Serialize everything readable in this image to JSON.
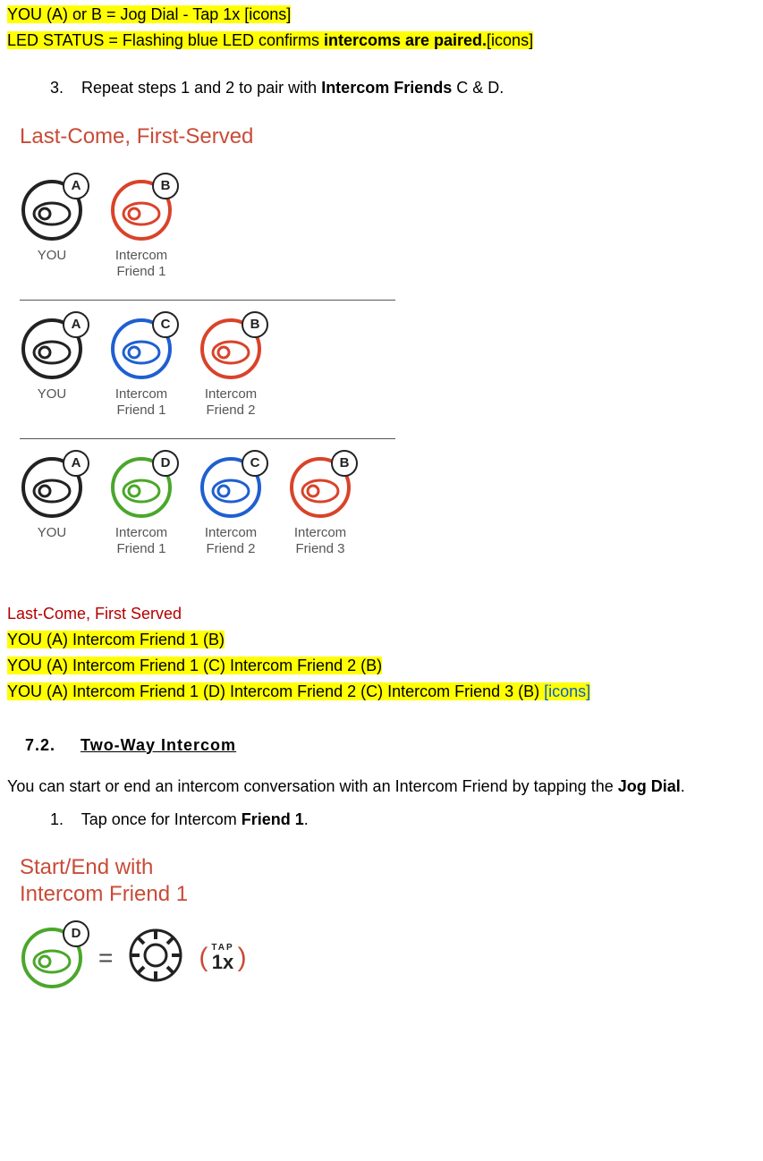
{
  "highlight1_prefix": "YOU (A) or B = Jog Dial - Tap 1x ",
  "highlight1_icons": "[icons]",
  "highlight2_prefix": "LED STATUS = Flashing blue LED confirms ",
  "highlight2_bold": "intercoms are paired.",
  "highlight2_icons": "[icons]",
  "step3_num": "3.",
  "step3_a": "Repeat steps 1 and 2 to pair with ",
  "step3_b": "Intercom Friends",
  "step3_c": " C & D.",
  "diagram_title": "Last-Come, First-Served",
  "labels": {
    "you": "YOU",
    "if1": "Intercom\nFriend 1",
    "if2": "Intercom\nFriend 2",
    "if3": "Intercom\nFriend 3"
  },
  "badges": {
    "A": "A",
    "B": "B",
    "C": "C",
    "D": "D"
  },
  "red_sub": "Last-Come, First Served",
  "hl_row1": "YOU (A) Intercom Friend 1 (B)",
  "hl_row2": "YOU (A) Intercom Friend 1 (C) Intercom Friend 2 (B)",
  "hl_row3_a": "YOU (A) Intercom Friend 1 (D) Intercom Friend 2 (C) Intercom Friend 3 (B) ",
  "hl_row3_b": "[icons]",
  "section_num": "7.2.",
  "section_title": "Two-Way Intercom",
  "para_a": "You can start or end an intercom conversation with an Intercom Friend by tapping the ",
  "para_b": "Jog Dial",
  "para_c": ".",
  "step1_num": "1.",
  "step1_a": "Tap once for Intercom ",
  "step1_b": "Friend 1",
  "step1_c": ".",
  "diagram2_l1": "Start/End with",
  "diagram2_l2": "Intercom Friend 1",
  "tap_top": "TAP",
  "tap_bot": "1x"
}
